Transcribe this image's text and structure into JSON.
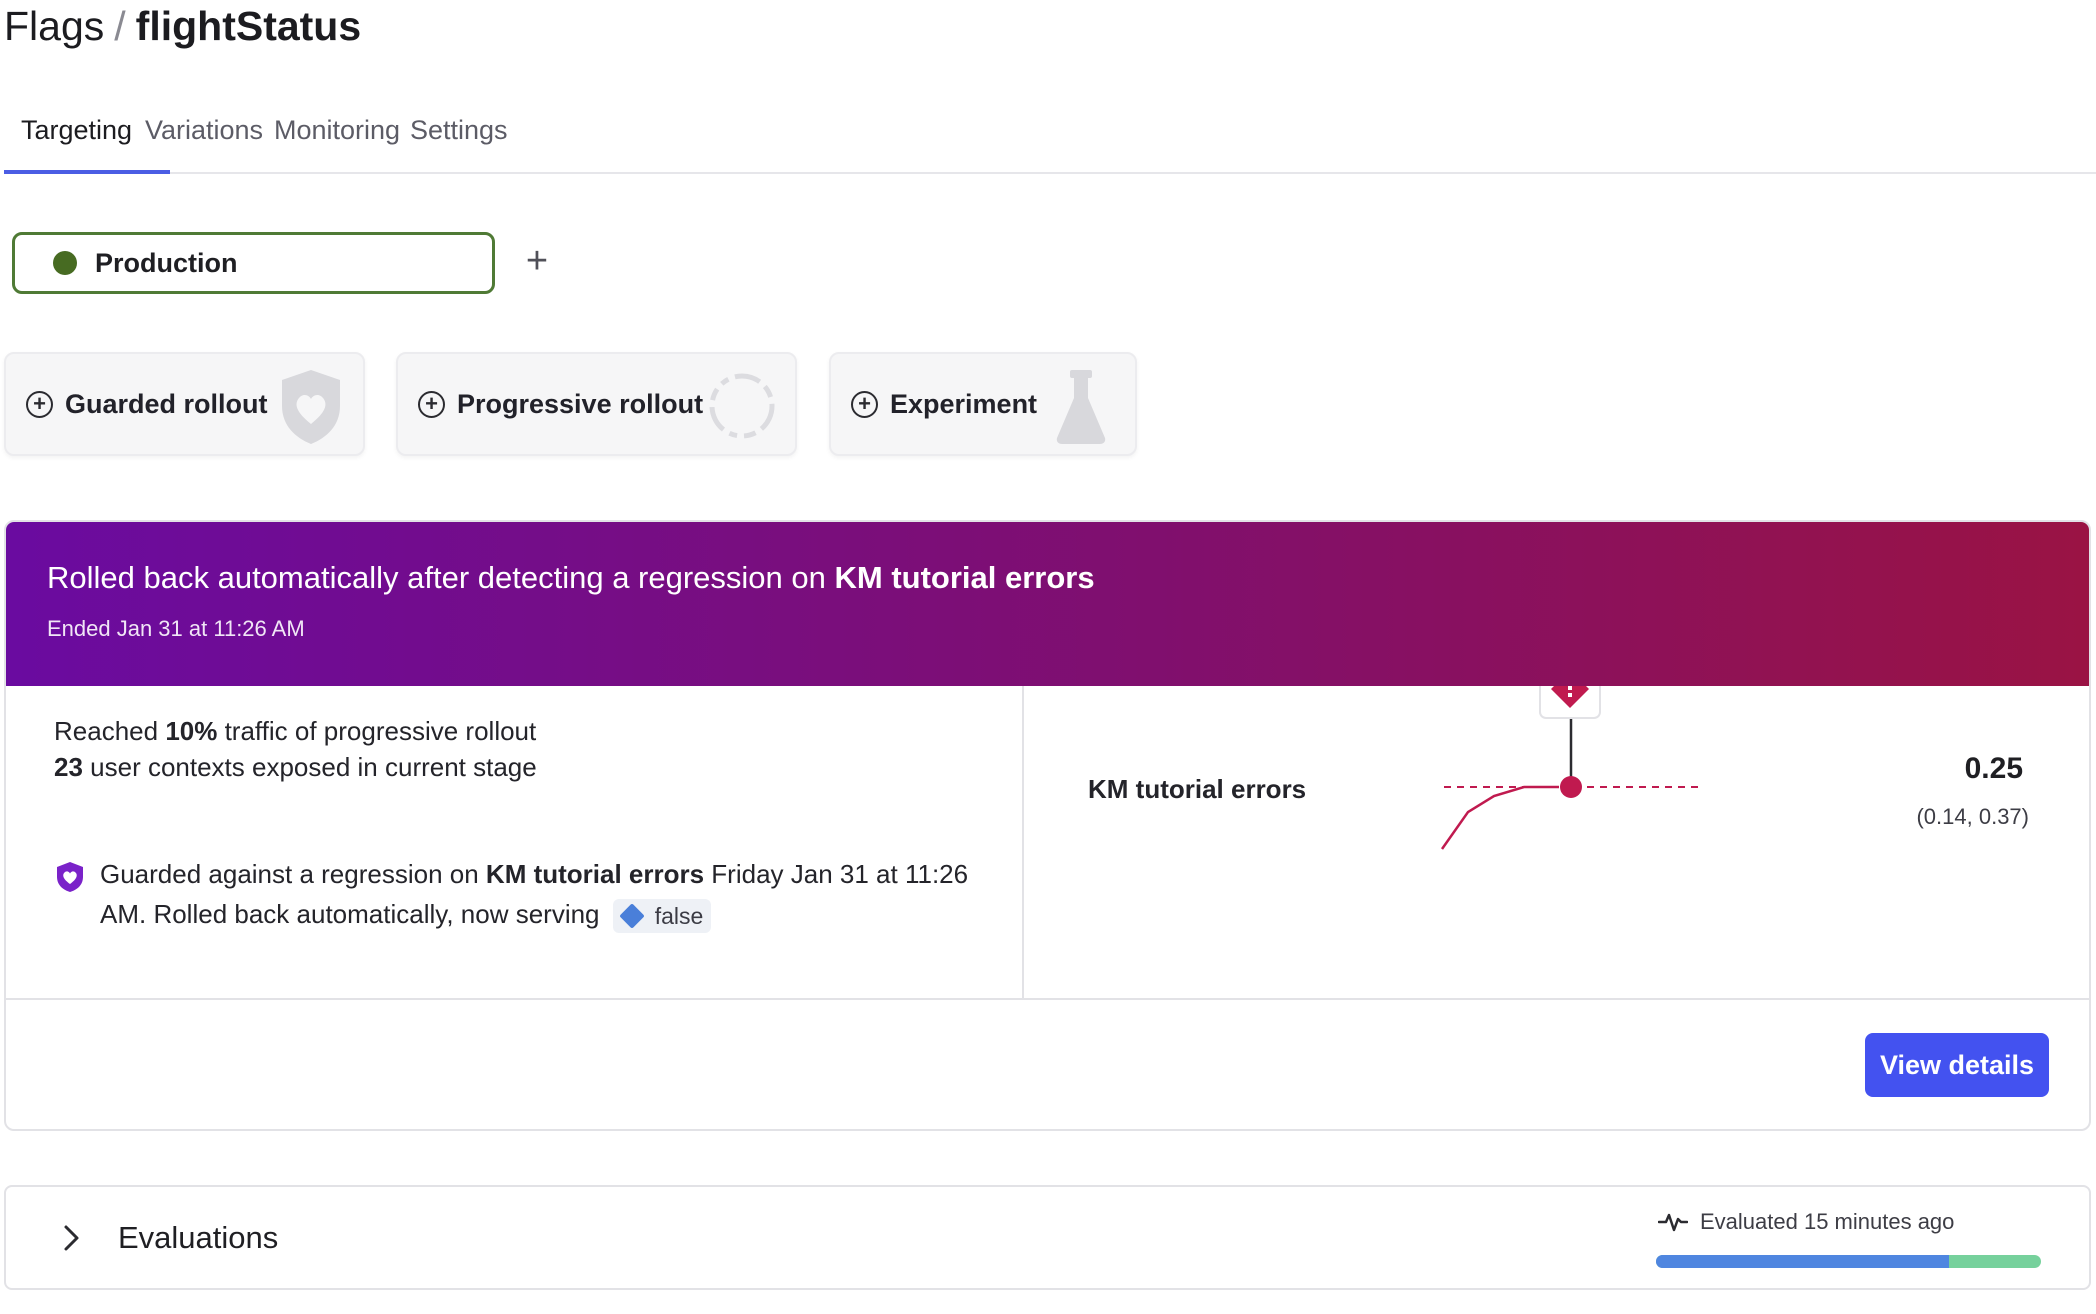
{
  "breadcrumb": {
    "root": "Flags",
    "separator": "/",
    "flag_key": "flightStatus"
  },
  "tabs": [
    {
      "label": "Targeting",
      "active": true
    },
    {
      "label": "Variations",
      "active": false
    },
    {
      "label": "Monitoring",
      "active": false
    },
    {
      "label": "Settings",
      "active": false
    }
  ],
  "environment": {
    "label": "Production",
    "dot_color": "#476b22",
    "add_label": "+"
  },
  "rollout_options": [
    {
      "label": "Guarded rollout",
      "icon": "shield-heart-icon"
    },
    {
      "label": "Progressive rollout",
      "icon": "dashed-circle-icon"
    },
    {
      "label": "Experiment",
      "icon": "flask-icon"
    }
  ],
  "rollback": {
    "title_prefix": "Rolled back automatically after detecting a regression on ",
    "metric": "KM tutorial errors",
    "ended": "Ended Jan 31 at 11:26 AM",
    "reached_prefix": "Reached ",
    "reached_pct": "10%",
    "reached_suffix": " traffic of progressive rollout",
    "contexts_count": "23",
    "contexts_suffix": " user contexts exposed in current stage",
    "guard_prefix": "Guarded against a regression on ",
    "guard_metric": "KM tutorial errors",
    "guard_suffix": " Friday Jan 31 at 11:26 AM. Rolled back automatically, now serving",
    "serving_variation": "false",
    "metric_value": "0.25",
    "metric_ci": "(0.14, 0.37)",
    "view_details_label": "View details",
    "colors": {
      "banner_start": "#6a0ba0",
      "banner_end": "#9a1344",
      "regression": "#c01a4f",
      "button": "#4352f0"
    }
  },
  "evaluations": {
    "title": "Evaluations",
    "status": "Evaluated 15 minutes ago",
    "bar_fill_fraction": 0.76,
    "bar_colors": {
      "primary": "#4f86e0",
      "secondary": "#76d19c"
    }
  }
}
